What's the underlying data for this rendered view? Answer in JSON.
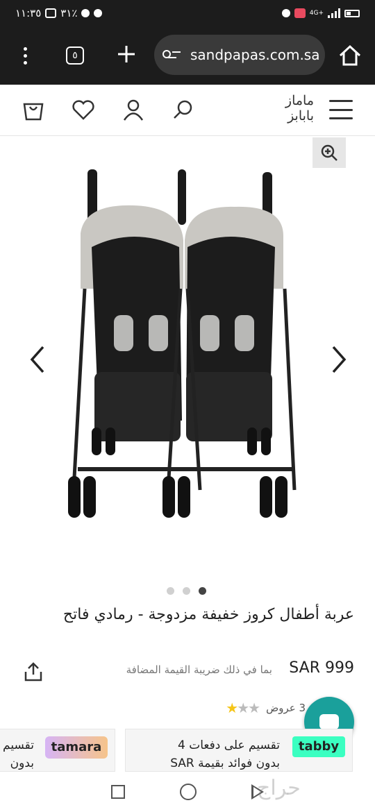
{
  "status_bar": {
    "time": "١١:٣٥",
    "battery": "٣١٪",
    "network": "4G+"
  },
  "browser": {
    "tabs_count": "٥",
    "url": "sandpapas.com.sa",
    "icons": [
      "menu-dots-icon",
      "tabs-icon",
      "plus-icon",
      "site-settings-icon",
      "home-icon"
    ]
  },
  "site_header": {
    "logo": {
      "line1": "ماماز",
      "line2": "بابابز"
    },
    "icons": [
      "bag-icon",
      "heart-icon",
      "user-icon",
      "search-icon",
      "hamburger-icon"
    ]
  },
  "gallery": {
    "image_alt": "double stroller",
    "dots_count": 3,
    "active_dot": 2
  },
  "product": {
    "title": "عربة أطفال كروز خفيفة مزدوجة - رمادي فاتح",
    "price": "SAR 999",
    "vat_note": "بما في ذلك ضريبة القيمة المضافة",
    "rating_text": "3 عروض",
    "rating_stars": 1
  },
  "installments": {
    "tabby": {
      "logo": "tabby",
      "line1": "تقسيم على دفعات 4",
      "line2": "بدون فوائد بقيمة SAR"
    },
    "tamara": {
      "logo": "tamara",
      "line1": "تقسيم",
      "line2": "بدون"
    }
  },
  "watermark": "حراج",
  "colors": {
    "browser_bg": "#1c1c1c",
    "url_bg": "#3a3a3a",
    "chat_fab": "#1aa09b",
    "tabby_accent": "#3bffc1"
  }
}
